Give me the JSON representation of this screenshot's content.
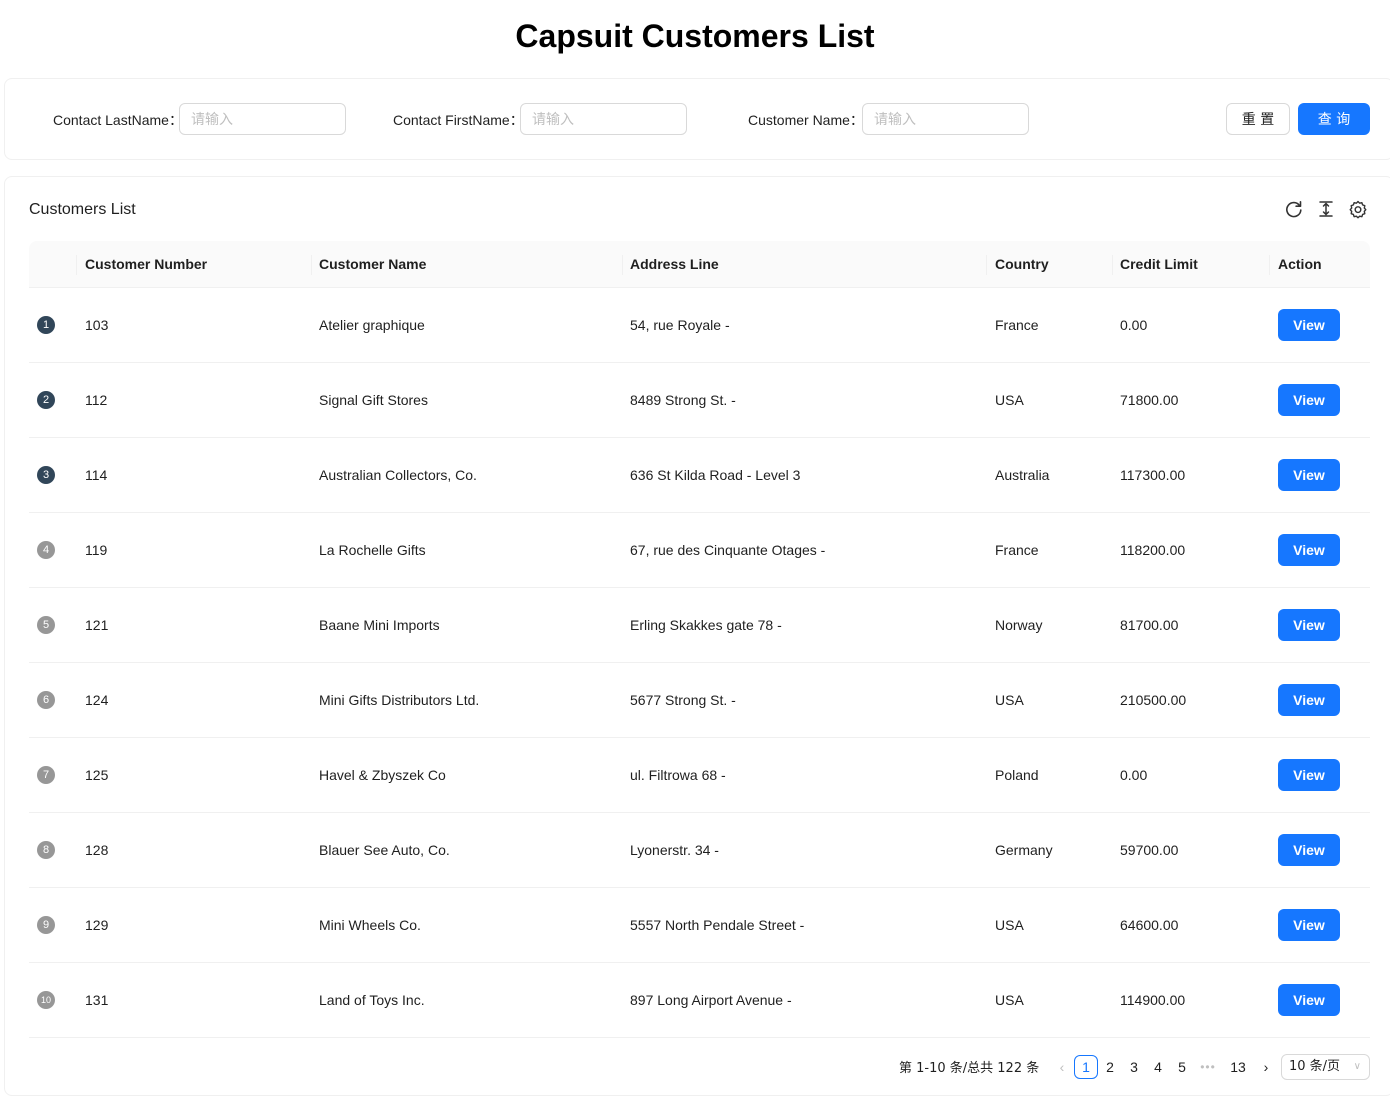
{
  "page": {
    "title": "Capsuit Customers List"
  },
  "search": {
    "fields": [
      {
        "label": "Contact LastName",
        "placeholder": "请输入",
        "value": ""
      },
      {
        "label": "Contact FirstName",
        "placeholder": "请输入",
        "value": ""
      },
      {
        "label": "Customer Name",
        "placeholder": "请输入",
        "value": ""
      }
    ],
    "reset_label": "重 置",
    "query_label": "查 询"
  },
  "list": {
    "title": "Customers List",
    "toolbar_icons": [
      "reload-icon",
      "density-icon",
      "settings-icon"
    ],
    "columns": [
      "Customer Number",
      "Customer Name",
      "Address Line",
      "Country",
      "Credit Limit",
      "Action"
    ],
    "rows": [
      {
        "index": "1",
        "number": "103",
        "name": "Atelier graphique",
        "address": "54, rue Royale -",
        "country": "France",
        "credit": "0.00",
        "action": "View"
      },
      {
        "index": "2",
        "number": "112",
        "name": "Signal Gift Stores",
        "address": "8489 Strong St. -",
        "country": "USA",
        "credit": "71800.00",
        "action": "View"
      },
      {
        "index": "3",
        "number": "114",
        "name": "Australian Collectors, Co.",
        "address": "636 St Kilda Road - Level 3",
        "country": "Australia",
        "credit": "117300.00",
        "action": "View"
      },
      {
        "index": "4",
        "number": "119",
        "name": "La Rochelle Gifts",
        "address": "67, rue des Cinquante Otages -",
        "country": "France",
        "credit": "118200.00",
        "action": "View"
      },
      {
        "index": "5",
        "number": "121",
        "name": "Baane Mini Imports",
        "address": "Erling Skakkes gate 78 -",
        "country": "Norway",
        "credit": "81700.00",
        "action": "View"
      },
      {
        "index": "6",
        "number": "124",
        "name": "Mini Gifts Distributors Ltd.",
        "address": "5677 Strong St. -",
        "country": "USA",
        "credit": "210500.00",
        "action": "View"
      },
      {
        "index": "7",
        "number": "125",
        "name": "Havel & Zbyszek Co",
        "address": "ul. Filtrowa 68 -",
        "country": "Poland",
        "credit": "0.00",
        "action": "View"
      },
      {
        "index": "8",
        "number": "128",
        "name": "Blauer See Auto, Co.",
        "address": "Lyonerstr. 34 -",
        "country": "Germany",
        "credit": "59700.00",
        "action": "View"
      },
      {
        "index": "9",
        "number": "129",
        "name": "Mini Wheels Co.",
        "address": "5557 North Pendale Street -",
        "country": "USA",
        "credit": "64600.00",
        "action": "View"
      },
      {
        "index": "10",
        "number": "131",
        "name": "Land of Toys Inc.",
        "address": "897 Long Airport Avenue -",
        "country": "USA",
        "credit": "114900.00",
        "action": "View"
      }
    ]
  },
  "pagination": {
    "total_text": "第 1-10 条/总共 122 条",
    "pages": [
      "1",
      "2",
      "3",
      "4",
      "5"
    ],
    "active_page": "1",
    "ellipsis": "•••",
    "last_page": "13",
    "page_size": "10 条/页"
  },
  "colors": {
    "primary": "#1677ff",
    "index_dark": "#314659",
    "index_light": "#979797"
  }
}
